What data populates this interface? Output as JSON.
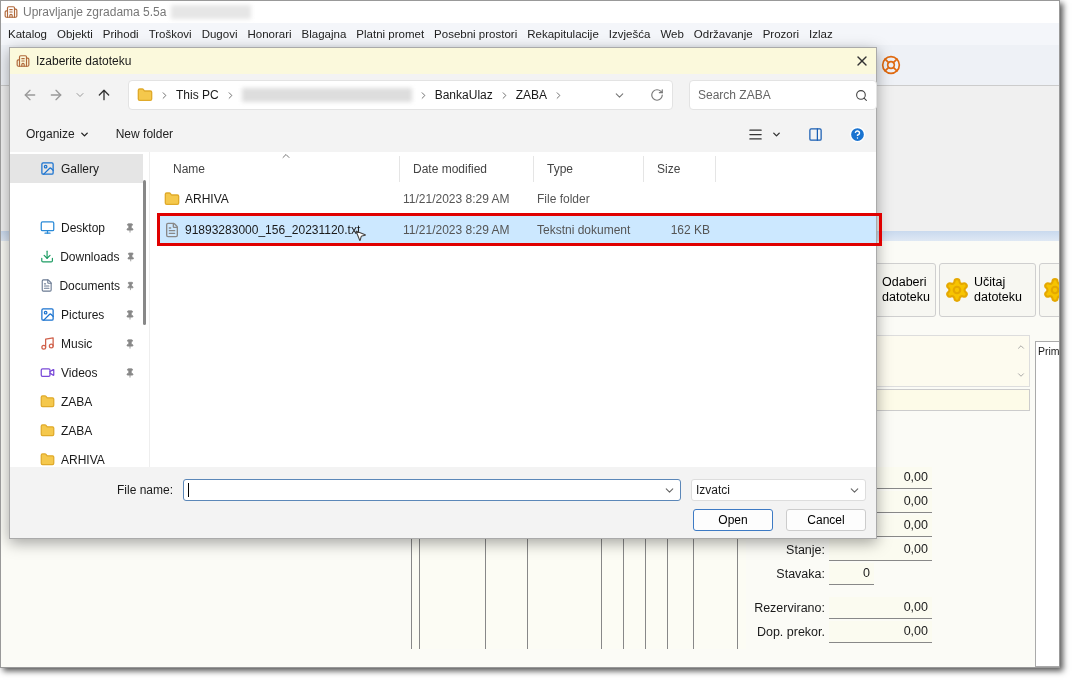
{
  "app": {
    "title": "Upravljanje zgradama 5.5a",
    "menu": [
      "Katalog",
      "Objekti",
      "Prihodi",
      "Troškovi",
      "Dugovi",
      "Honorari",
      "Blagajna",
      "Platni promet",
      "Posebni prostori",
      "Rekapitulacije",
      "Izvješća",
      "Web",
      "Održavanje",
      "Prozori",
      "Izlaz"
    ],
    "buttons": [
      {
        "label": "Odaberi datoteku"
      },
      {
        "label": "Učitaj datoteku"
      }
    ],
    "amounts": [
      {
        "value": "0,00"
      },
      {
        "value": "0,00"
      },
      {
        "value": "0,00"
      },
      {
        "label": "Stanje:",
        "value": "0,00"
      },
      {
        "label": "Stavaka:",
        "value": "0",
        "kind": "count"
      },
      {
        "label": "Rezervirano:",
        "value": "0,00"
      },
      {
        "label": "Dop. prekor.",
        "value": "0,00"
      }
    ],
    "list_header": "Prim"
  },
  "dialog": {
    "title": "Izaberite datoteku",
    "address": [
      "This PC",
      "BankaUlaz",
      "ZABA"
    ],
    "search": {
      "placeholder": "Search ZABA"
    },
    "commands": {
      "organize": "Organize",
      "new_folder": "New folder"
    },
    "nav_pane": [
      {
        "label": "Gallery",
        "kind": "library",
        "selected": true,
        "pinned": false
      },
      {
        "label": "Desktop",
        "kind": "library",
        "selected": false,
        "pinned": true
      },
      {
        "label": "Downloads",
        "kind": "library",
        "selected": false,
        "pinned": true
      },
      {
        "label": "Documents",
        "kind": "library",
        "selected": false,
        "pinned": true
      },
      {
        "label": "Pictures",
        "kind": "library",
        "selected": false,
        "pinned": true
      },
      {
        "label": "Music",
        "kind": "library",
        "selected": false,
        "pinned": true
      },
      {
        "label": "Videos",
        "kind": "library",
        "selected": false,
        "pinned": true
      },
      {
        "label": "ZABA",
        "kind": "folder",
        "selected": false,
        "pinned": false
      },
      {
        "label": "ZABA",
        "kind": "folder",
        "selected": false,
        "pinned": false
      },
      {
        "label": "ARHIVA",
        "kind": "folder",
        "selected": false,
        "pinned": false
      }
    ],
    "columns": [
      "Name",
      "Date modified",
      "Type",
      "Size"
    ],
    "rows": [
      {
        "kind": "folder",
        "name": "ARHIVA",
        "date": "11/21/2023 8:29 AM",
        "type": "File folder",
        "selected": false,
        "annotated": false
      },
      {
        "kind": "file",
        "name": "91893283000_156_20231120.txt",
        "date": "11/21/2023 8:29 AM",
        "type": "Tekstni dokument",
        "size": "162 KB",
        "selected": true,
        "annotated": true
      }
    ],
    "file_name_label": "File name:",
    "filter": "Izvatci",
    "buttons": [
      {
        "label": "Open",
        "primary": true
      },
      {
        "label": "Cancel",
        "primary": false
      }
    ]
  }
}
